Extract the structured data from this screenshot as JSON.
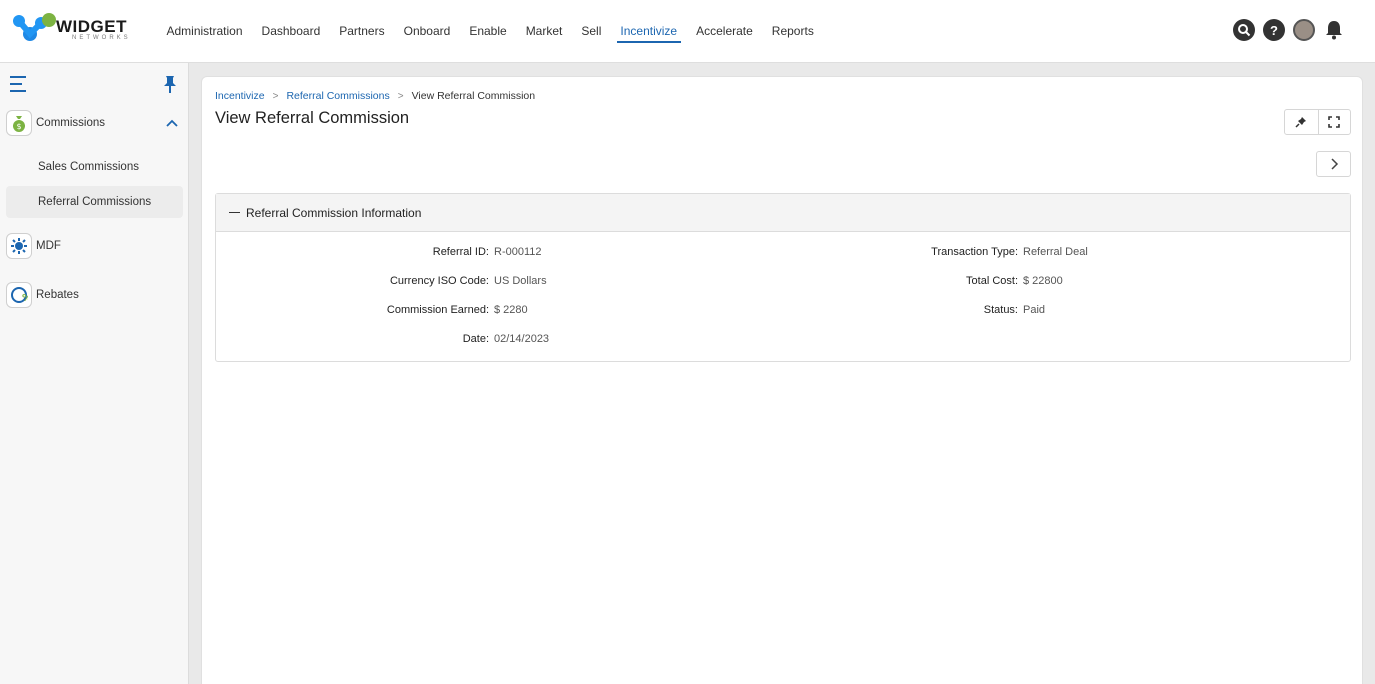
{
  "brand": {
    "name": "WIDGET",
    "tagline": "NETWORKS"
  },
  "nav": {
    "items": [
      "Administration",
      "Dashboard",
      "Partners",
      "Onboard",
      "Enable",
      "Market",
      "Sell",
      "Incentivize",
      "Accelerate",
      "Reports"
    ],
    "active": "Incentivize"
  },
  "sidebar": {
    "groups": [
      {
        "label": "Commissions",
        "icon": "money-bag-icon"
      },
      {
        "label": "MDF",
        "icon": "gear-network-icon"
      },
      {
        "label": "Rebates",
        "icon": "percent-icon"
      }
    ],
    "sub_items": [
      "Sales Commissions",
      "Referral Commissions"
    ],
    "selected_sub": "Referral Commissions"
  },
  "breadcrumb": {
    "items": [
      "Incentivize",
      "Referral Commissions",
      "View Referral Commission"
    ]
  },
  "page": {
    "title": "View Referral Commission"
  },
  "panel": {
    "title": "Referral Commission Information",
    "left_fields": [
      {
        "label": "Referral ID:",
        "value": "R-000112"
      },
      {
        "label": "Currency ISO Code:",
        "value": "US Dollars"
      },
      {
        "label": "Commission Earned:",
        "value": "$ 2280"
      },
      {
        "label": "Date:",
        "value": "02/14/2023"
      }
    ],
    "right_fields": [
      {
        "label": "Transaction Type:",
        "value": "Referral Deal"
      },
      {
        "label": "Total Cost:",
        "value": "$ 22800"
      },
      {
        "label": "Status:",
        "value": "Paid"
      }
    ]
  },
  "colors": {
    "accent": "#1c66b0",
    "logo_green": "#7cb342",
    "logo_blue": "#2196f3"
  }
}
